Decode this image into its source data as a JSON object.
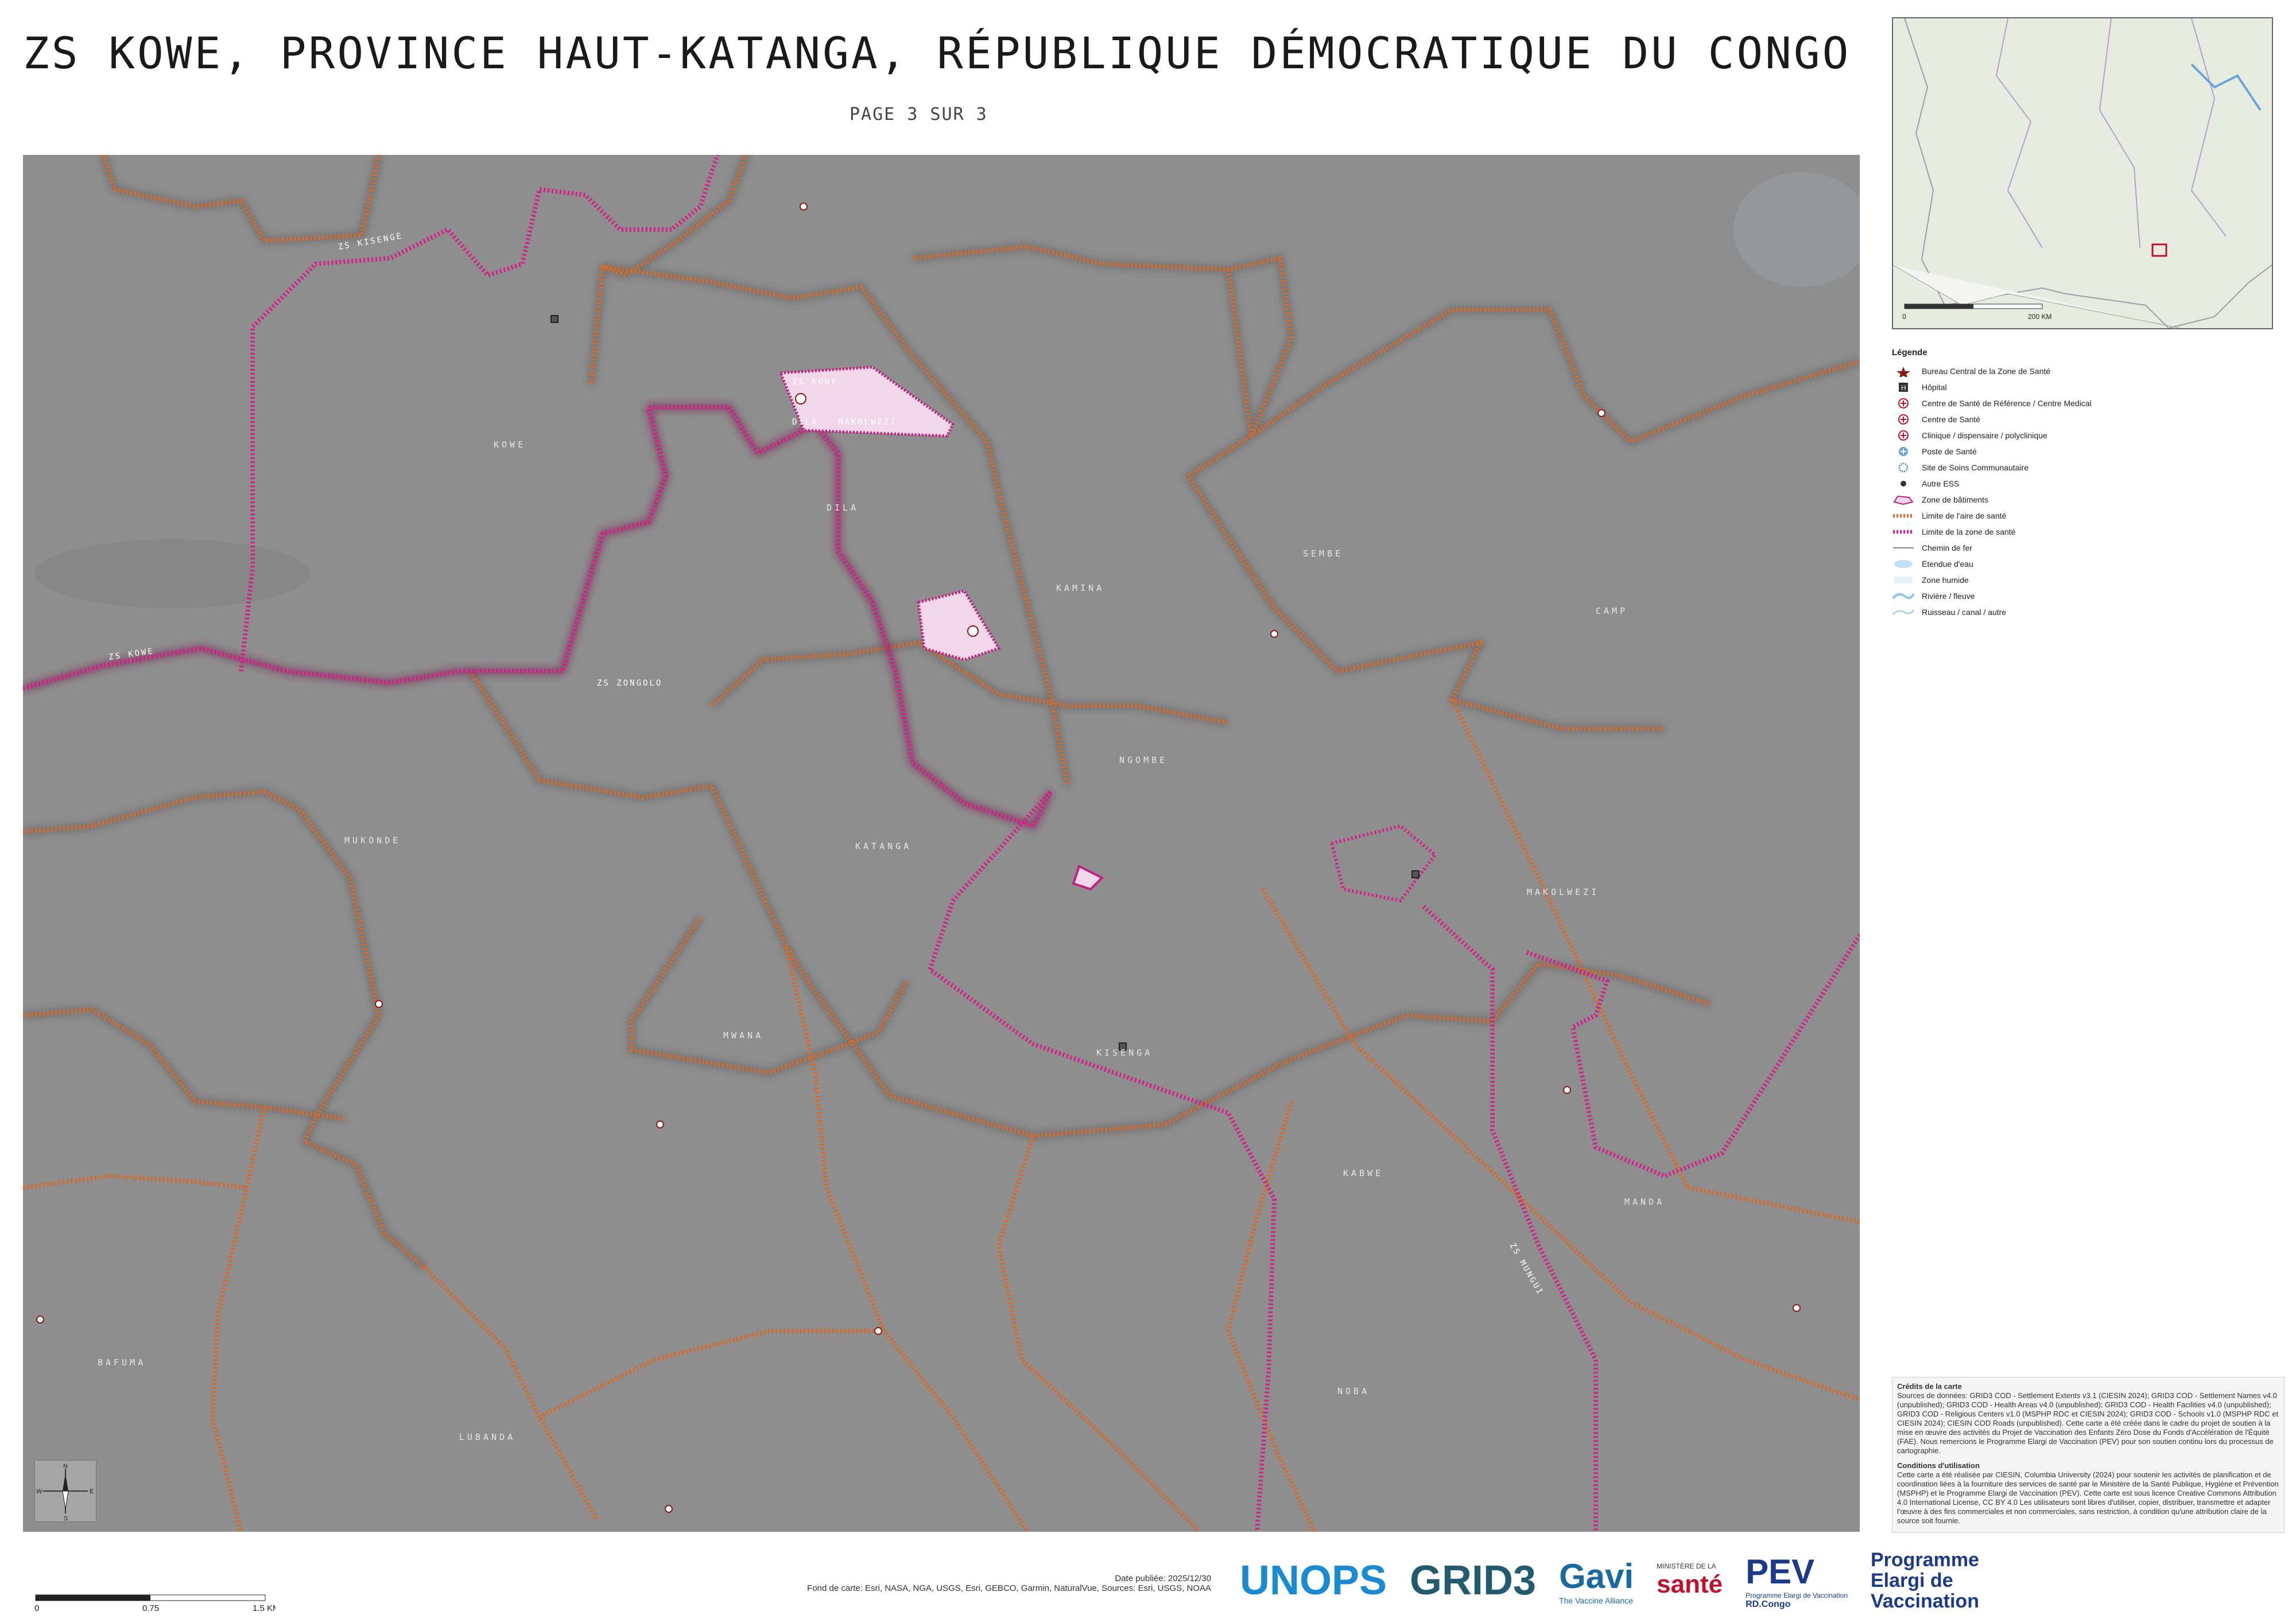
{
  "title": "ZS KOWE, PROVINCE HAUT-KATANGA, RÉPUBLIQUE DÉMOCRATIQUE DU CONGO",
  "subtitle": "PAGE 3 SUR 3",
  "map": {
    "area_labels": [
      "KOWE",
      "DILA",
      "KATANGA",
      "NGOMBE",
      "MWANA",
      "SEMBE",
      "KISENGA",
      "MUKONDE",
      "KABWE",
      "LUBANDA",
      "NOBA",
      "BAFUMA",
      "KAMINA",
      "MANDA",
      "CAMP",
      "MAKOLWEZI"
    ],
    "zone_labels": [
      "ZS KOWE",
      "ZS ZONGOLO",
      "ZS KISENGE",
      "ZS MUNGUI"
    ],
    "settlement_labels": [
      "ZS KOWE",
      "DILA",
      "MAKOLWEZI"
    ],
    "colors": {
      "map_bg": "#8c8c8c",
      "health_area_boundary": "#d96a2a",
      "health_zone_boundary": "#d61f8a",
      "building_zone": "#f2d6ea"
    }
  },
  "inset": {
    "scale_label": "200 KM",
    "scale_start": "0"
  },
  "legend": {
    "title": "Légende",
    "items": [
      {
        "label": "Bureau Central de la Zone de Santé",
        "icon": "star-icon"
      },
      {
        "label": "Hôpital",
        "icon": "hospital-icon"
      },
      {
        "label": "Centre de Santé de Référence / Centre Medical",
        "icon": "reference-center-icon"
      },
      {
        "label": "Centre de Santé",
        "icon": "health-center-icon"
      },
      {
        "label": "Clinique / dispensaire / polyclinique",
        "icon": "clinic-icon"
      },
      {
        "label": "Poste de Santé",
        "icon": "health-post-icon"
      },
      {
        "label": "Site de Soins Communautaire",
        "icon": "community-site-icon"
      },
      {
        "label": "Autre ESS",
        "icon": "other-ess-icon"
      },
      {
        "label": "Zone de bâtiments",
        "icon": "building-zone-icon"
      },
      {
        "label": "Limite de l'aire de santé",
        "icon": "health-area-line-icon"
      },
      {
        "label": "Limite de la zone de santé",
        "icon": "health-zone-line-icon"
      },
      {
        "label": "Chemin de fer",
        "icon": "railway-icon"
      },
      {
        "label": "Étendue d'eau",
        "icon": "water-body-icon"
      },
      {
        "label": "Zone humide",
        "icon": "wetland-icon"
      },
      {
        "label": "Rivière / fleuve",
        "icon": "river-icon"
      },
      {
        "label": "Ruisseau / canal / autre",
        "icon": "stream-icon"
      }
    ]
  },
  "credits": {
    "heading": "Crédits de la carte",
    "body": "Sources de données: GRID3 COD - Settlement Extents v3.1 (CIESIN 2024); GRID3 COD - Settlement Names v4.0 (unpublished); GRID3 COD - Health Areas v4.0 (unpublished); GRID3 COD - Health Facilities v4.0 (unpublished); GRID3 COD - Religious Centers v1.0 (MSPHP RDC et CIESIN 2024); GRID3 COD - Schools v1.0 (MSPHP RDC et CIESIN 2024); CIESIN COD Roads (unpublished). Cette carte a été créée dans le cadre du projet de soutien à la mise en œuvre des activités du Projet de Vaccination des Enfants Zéro Dose du Fonds d'Accélération de l'Équité (FAE). Nous remercions le Programme Elargi de Vaccination (PEV) pour son soutien continu lors du processus de cartographie.",
    "conditions_heading": "Conditions d'utilisation",
    "conditions": "Cette carte a été réalisée par CIESIN, Columbia University (2024) pour soutenir les activités de planification et de coordination liées à la fourniture des services de santé par le Ministère de la Santé Publique, Hygiène et Prévention (MSPHP) et le Programme Elargi de Vaccination (PEV). Cette carte est sous licence Creative Commons Attribution 4.0 International License, CC BY 4.0 Les utilisateurs sont libres d'utiliser, copier, distribuer, transmettre et adapter l'œuvre à des fins commerciales et non commerciales, sans restriction, à condition qu'une attribution claire de la source soit fournie."
  },
  "footer": {
    "date": "Date publiée: 2025/12/30",
    "basemap": "Fond de carte: Esri, NASA, NGA, USGS, Esri, GEBCO, Garmin, NaturalVue, Sources: Esri, USGS, NOAA",
    "scale": [
      "0",
      "0.75",
      "1.5 KM"
    ],
    "logos": [
      "UNOPS",
      "GRID3",
      "Gavi",
      "The Vaccine Alliance",
      "MINISTÈRE DE LA",
      "santé",
      "PEV",
      "Programme Elargi de Vaccination",
      "RD.Congo",
      "Programme",
      "Elargi de",
      "Vaccination"
    ]
  },
  "compass": {
    "n": "N",
    "s": "S",
    "e": "E",
    "w": "W"
  }
}
